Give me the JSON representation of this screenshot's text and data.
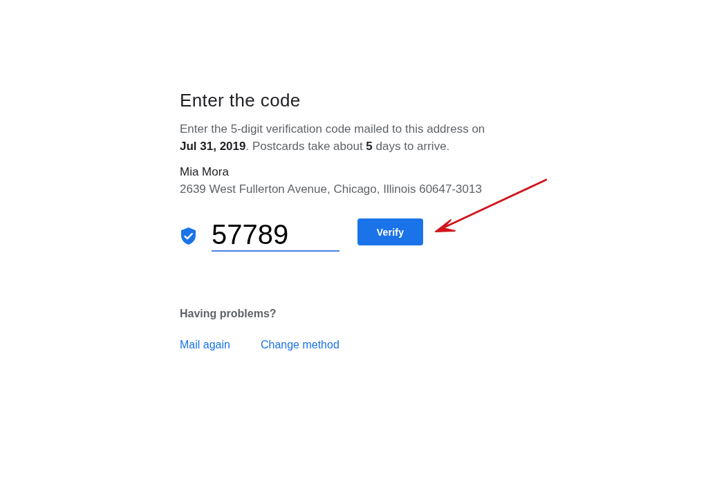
{
  "heading": "Enter the code",
  "description": "Enter the 5-digit verification code mailed to this address on **Jul 31, 2019**. Postcards take about **5** days to arrive.",
  "recipient": {
    "name": "Mia Mora",
    "address": "2639 West Fullerton Avenue, Chicago, Illinois 60647-3013"
  },
  "code_field": {
    "value": "57789",
    "focused": true
  },
  "verify_button": {
    "label": "Verify"
  },
  "help": {
    "heading": "Having problems?",
    "links": [
      "Mail again",
      "Change method"
    ]
  }
}
